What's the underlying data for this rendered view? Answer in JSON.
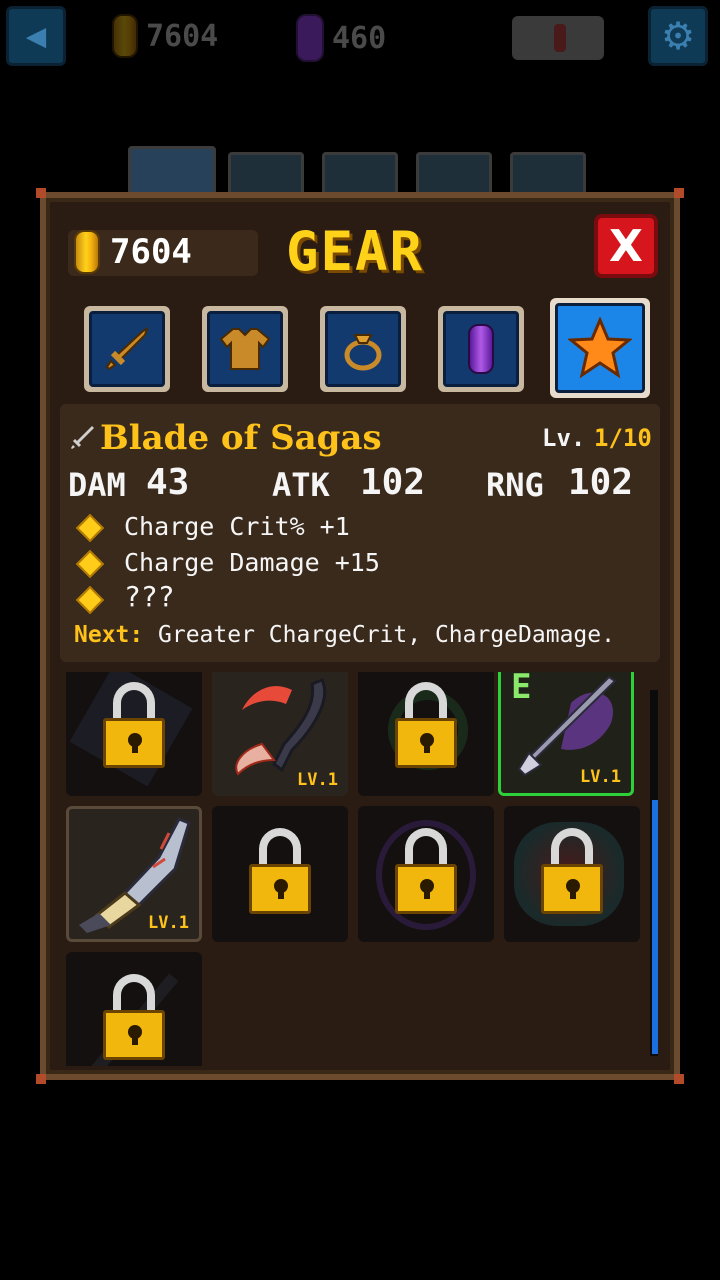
{
  "top_bar": {
    "back_label": "◀",
    "gold": "7604",
    "gems": "460",
    "settings_label": "⚙"
  },
  "panel": {
    "gold": "7604",
    "title": "GEAR",
    "close_label": "X",
    "tabs": [
      {
        "name": "weapon",
        "icon": "sword-icon"
      },
      {
        "name": "armor",
        "icon": "shirt-icon"
      },
      {
        "name": "ring",
        "icon": "ring-icon"
      },
      {
        "name": "gem",
        "icon": "gem-icon"
      },
      {
        "name": "special",
        "icon": "star-icon",
        "active": true
      }
    ]
  },
  "item": {
    "name": "Blade of Sagas",
    "level_label": "Lv.",
    "level_value": "1/10",
    "stats": {
      "dam_label": "DAM",
      "dam_value": "43",
      "atk_label": "ATK",
      "atk_value": "102",
      "rng_label": "RNG",
      "rng_value": "102"
    },
    "perks": [
      "Charge Crit% +1",
      "Charge Damage +15",
      "???"
    ],
    "next_label": "Next:",
    "next_value": "Greater ChargeCrit, ChargeDamage."
  },
  "grid": {
    "level_text": "LV.1",
    "equipped_mark": "E",
    "slots": [
      {
        "locked": true
      },
      {
        "locked": false,
        "level": "LV.1"
      },
      {
        "locked": true
      },
      {
        "locked": false,
        "level": "LV.1",
        "equipped": true
      },
      {
        "locked": false,
        "level": "LV.1"
      },
      {
        "locked": true
      },
      {
        "locked": true
      },
      {
        "locked": true
      },
      {
        "locked": true
      }
    ]
  },
  "colors": {
    "accent_gold": "#ffc21a",
    "panel_brown": "#2a1c12",
    "active_tab_blue": "#1c86e8",
    "equipped_green": "#2ed03a",
    "close_red": "#d6161c"
  }
}
